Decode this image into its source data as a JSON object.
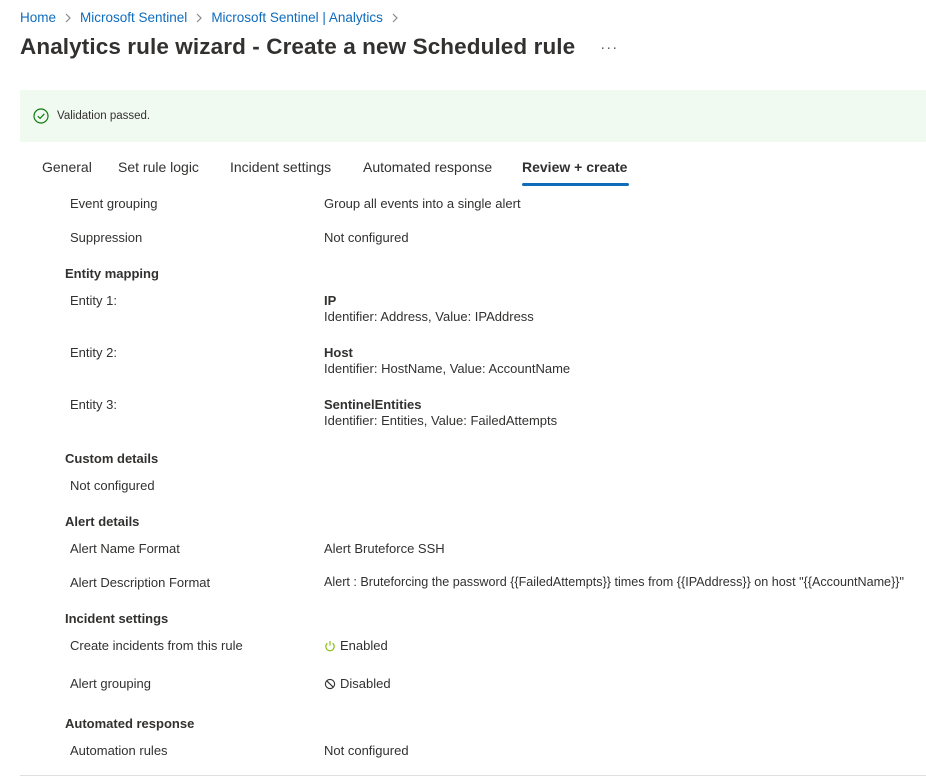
{
  "breadcrumb": [
    "Home",
    "Microsoft Sentinel",
    "Microsoft Sentinel | Analytics"
  ],
  "title": "Analytics rule wizard - Create a new Scheduled rule",
  "more_label": "···",
  "banner": {
    "message": "Validation passed.",
    "icon": "checkmark-circle-icon",
    "color": "#107c10"
  },
  "tabs": [
    "General",
    "Set rule logic",
    "Incident settings",
    "Automated response",
    "Review + create"
  ],
  "active_tab": "Review + create",
  "rows": {
    "event_grouping": {
      "label": "Event grouping",
      "value": "Group all events into a single alert"
    },
    "suppression": {
      "label": "Suppression",
      "value": "Not configured"
    }
  },
  "entity_mapping": {
    "heading": "Entity mapping",
    "entities": [
      {
        "label": "Entity 1:",
        "type": "IP",
        "detail": "Identifier: Address, Value: IPAddress"
      },
      {
        "label": "Entity 2:",
        "type": "Host",
        "detail": "Identifier: HostName, Value: AccountName"
      },
      {
        "label": "Entity 3:",
        "type": "SentinelEntities",
        "detail": "Identifier: Entities, Value: FailedAttempts"
      }
    ]
  },
  "custom_details": {
    "heading": "Custom details",
    "value": "Not configured"
  },
  "alert_details": {
    "heading": "Alert details",
    "name_format": {
      "label": "Alert Name Format",
      "value": "Alert Bruteforce SSH"
    },
    "description_format": {
      "label": "Alert Description Format",
      "value": "Alert : Bruteforcing the password {{FailedAttempts}} times from {{IPAddress}} on host \"{{AccountName}}\""
    }
  },
  "incident_settings": {
    "heading": "Incident settings",
    "create_incidents": {
      "label": "Create incidents from this rule",
      "value": "Enabled",
      "icon": "power-icon",
      "color": "#8cbd18"
    },
    "alert_grouping": {
      "label": "Alert grouping",
      "value": "Disabled",
      "icon": "blocked-icon"
    }
  },
  "automated_response": {
    "heading": "Automated response",
    "automation_rules": {
      "label": "Automation rules",
      "value": "Not configured"
    }
  },
  "colors": {
    "link": "#0f6cbd",
    "banner_bg": "#f1faf1",
    "tab_underline": "#0f6cbd"
  }
}
